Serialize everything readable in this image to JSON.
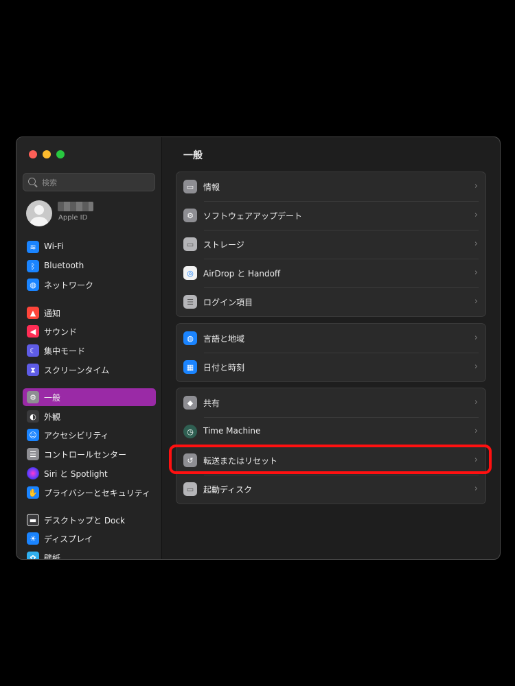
{
  "window": {
    "search": {
      "placeholder": "検索"
    },
    "account": {
      "subtitle": "Apple ID"
    }
  },
  "sidebar": {
    "items": [
      {
        "label": "Wi-Fi",
        "icon": "wifi-icon"
      },
      {
        "label": "Bluetooth",
        "icon": "bluetooth-icon"
      },
      {
        "label": "ネットワーク",
        "icon": "globe-icon"
      },
      {
        "label": "通知",
        "icon": "bell-icon"
      },
      {
        "label": "サウンド",
        "icon": "speaker-icon"
      },
      {
        "label": "集中モード",
        "icon": "moon-icon"
      },
      {
        "label": "スクリーンタイム",
        "icon": "hourglass-icon"
      },
      {
        "label": "一般",
        "icon": "gear-icon",
        "active": true
      },
      {
        "label": "外観",
        "icon": "appearance-icon"
      },
      {
        "label": "アクセシビリティ",
        "icon": "accessibility-icon"
      },
      {
        "label": "コントロールセンター",
        "icon": "toggles-icon"
      },
      {
        "label": "Siri と Spotlight",
        "icon": "siri-icon"
      },
      {
        "label": "プライバシーとセキュリティ",
        "icon": "hand-icon"
      },
      {
        "label": "デスクトップと Dock",
        "icon": "dock-icon"
      },
      {
        "label": "ディスプレイ",
        "icon": "sun-icon"
      },
      {
        "label": "壁紙",
        "icon": "flower-icon"
      }
    ]
  },
  "main": {
    "title": "一般",
    "groups": [
      {
        "rows": [
          {
            "label": "情報",
            "icon": "display-icon"
          },
          {
            "label": "ソフトウェアアップデート",
            "icon": "gear-badge-icon"
          },
          {
            "label": "ストレージ",
            "icon": "drive-icon"
          },
          {
            "label": "AirDrop と Handoff",
            "icon": "airdrop-icon"
          },
          {
            "label": "ログイン項目",
            "icon": "list-icon"
          }
        ]
      },
      {
        "rows": [
          {
            "label": "言語と地域",
            "icon": "globe-icon"
          },
          {
            "label": "日付と時刻",
            "icon": "calendar-clock-icon"
          }
        ]
      },
      {
        "rows": [
          {
            "label": "共有",
            "icon": "sharing-icon"
          },
          {
            "label": "Time Machine",
            "icon": "time-machine-icon"
          },
          {
            "label": "転送またはリセット",
            "icon": "reset-icon"
          },
          {
            "label": "起動ディスク",
            "icon": "startup-disk-icon"
          }
        ]
      }
    ]
  },
  "colors": {
    "accent": "#9a2aa6",
    "highlight": "#ff1010",
    "background": "#1e1e1e"
  }
}
